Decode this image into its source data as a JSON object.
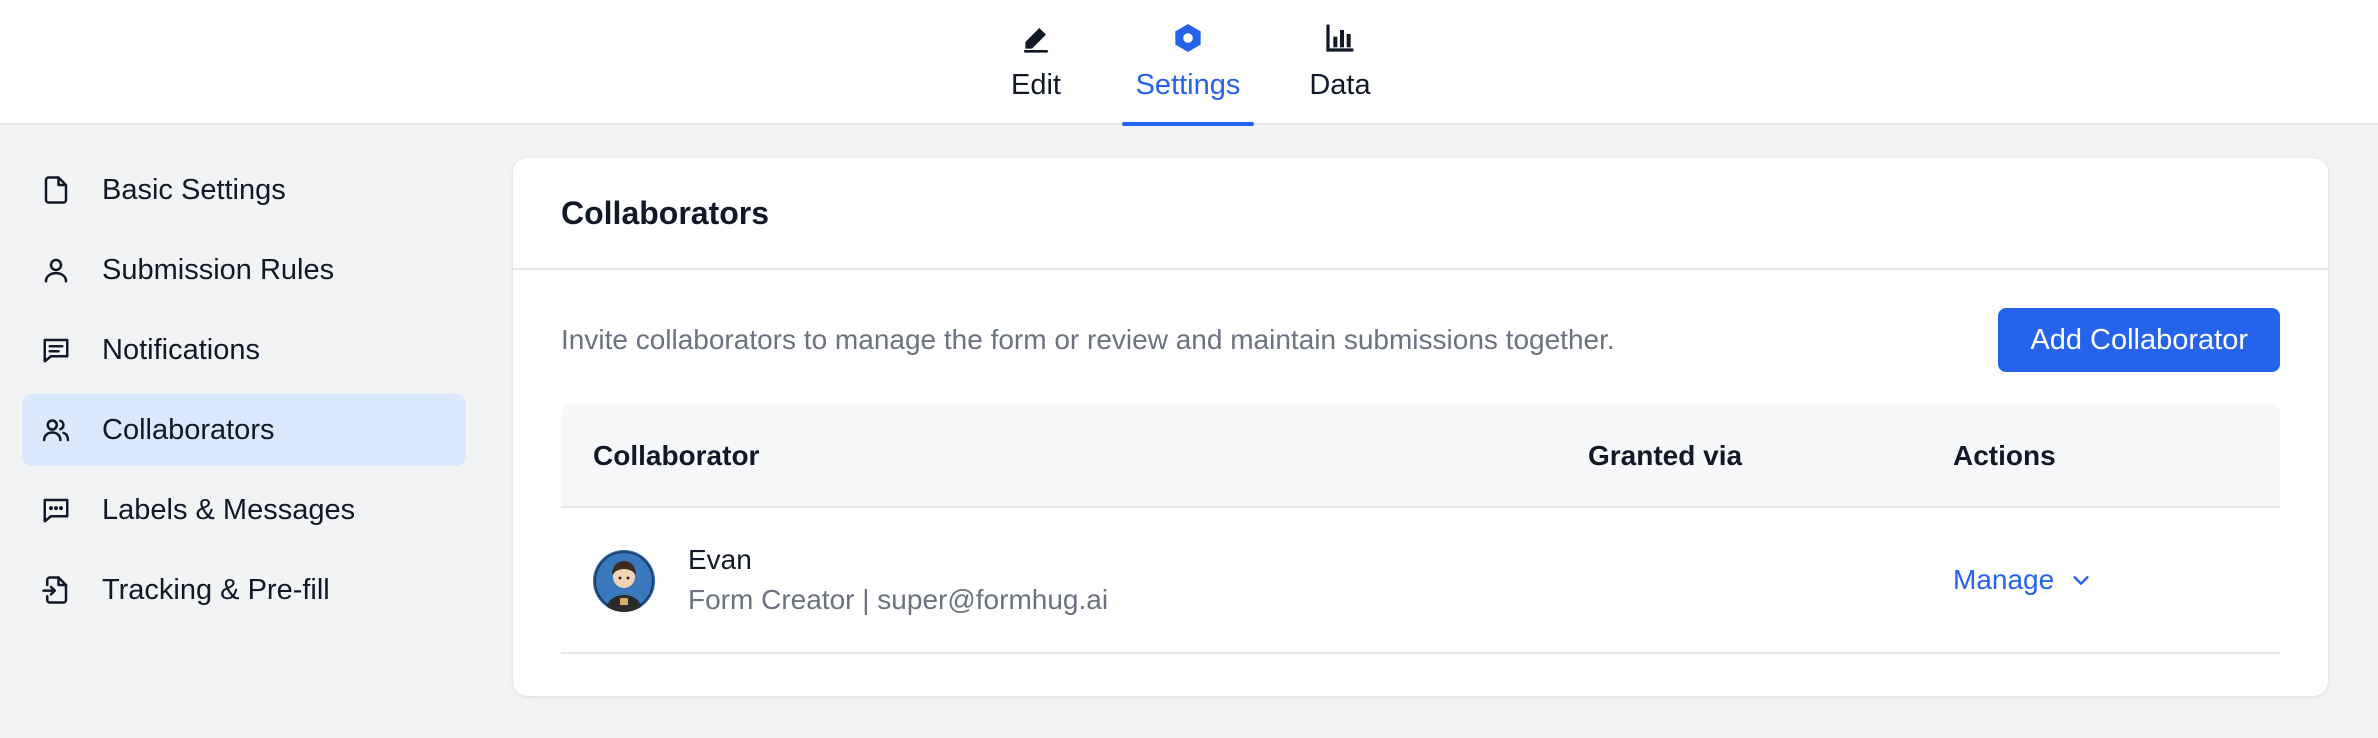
{
  "tabs": [
    {
      "label": "Edit",
      "icon": "pencil-icon"
    },
    {
      "label": "Settings",
      "icon": "hexagon-gear-icon"
    },
    {
      "label": "Data",
      "icon": "bar-chart-icon"
    }
  ],
  "active_tab": "Settings",
  "sidebar": {
    "items": [
      {
        "label": "Basic Settings",
        "icon": "document-icon"
      },
      {
        "label": "Submission Rules",
        "icon": "user-icon"
      },
      {
        "label": "Notifications",
        "icon": "message-square-icon"
      },
      {
        "label": "Collaborators",
        "icon": "users-icon"
      },
      {
        "label": "Labels & Messages",
        "icon": "chat-dots-icon"
      },
      {
        "label": "Tracking & Pre-fill",
        "icon": "file-import-icon"
      }
    ],
    "active": "Collaborators"
  },
  "card": {
    "title": "Collaborators",
    "intro": "Invite collaborators to manage the form or review and maintain submissions together.",
    "add_button": "Add Collaborator"
  },
  "table": {
    "headers": {
      "collaborator": "Collaborator",
      "granted_via": "Granted via",
      "actions": "Actions"
    },
    "rows": [
      {
        "name": "Evan",
        "subtitle": "Form Creator | super@formhug.ai",
        "granted_via": "",
        "action": "Manage"
      }
    ]
  },
  "colors": {
    "accent": "#2563eb",
    "active_bg": "#dbe9ff",
    "page_bg": "#f2f3f5",
    "muted_text": "#6b7280"
  }
}
